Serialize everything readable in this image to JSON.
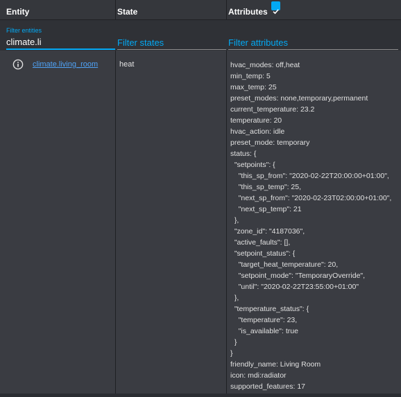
{
  "header": {
    "entity_label": "Entity",
    "state_label": "State",
    "attributes_label": "Attributes",
    "attributes_checked": true
  },
  "filters": {
    "entity_label": "Filter entities",
    "entity_value": "climate.li",
    "state_placeholder": "Filter states",
    "attributes_placeholder": "Filter attributes"
  },
  "row": {
    "info_icon": "info-icon",
    "entity_id": "climate.living_room",
    "state": "heat",
    "attributes": [
      "hvac_modes: off,heat",
      "min_temp: 5",
      "max_temp: 25",
      "preset_modes: none,temporary,permanent",
      "current_temperature: 23.2",
      "temperature: 20",
      "hvac_action: idle",
      "preset_mode: temporary",
      "status: {",
      "  \"setpoints\": {",
      "    \"this_sp_from\": \"2020-02-22T20:00:00+01:00\",",
      "    \"this_sp_temp\": 25,",
      "    \"next_sp_from\": \"2020-02-23T02:00:00+01:00\",",
      "    \"next_sp_temp\": 21",
      "  },",
      "  \"zone_id\": \"4187036\",",
      "  \"active_faults\": [],",
      "  \"setpoint_status\": {",
      "    \"target_heat_temperature\": 20,",
      "    \"setpoint_mode\": \"TemporaryOverride\",",
      "    \"until\": \"2020-02-22T23:55:00+01:00\"",
      "  },",
      "  \"temperature_status\": {",
      "    \"temperature\": 23,",
      "    \"is_available\": true",
      "  }",
      "}",
      "friendly_name: Living Room",
      "icon: mdi:radiator",
      "supported_features: 17"
    ]
  },
  "colors": {
    "accent": "#03a9f4",
    "link": "#4fa3f7",
    "background": "#2b2d32",
    "row_background": "#3a3c42"
  }
}
